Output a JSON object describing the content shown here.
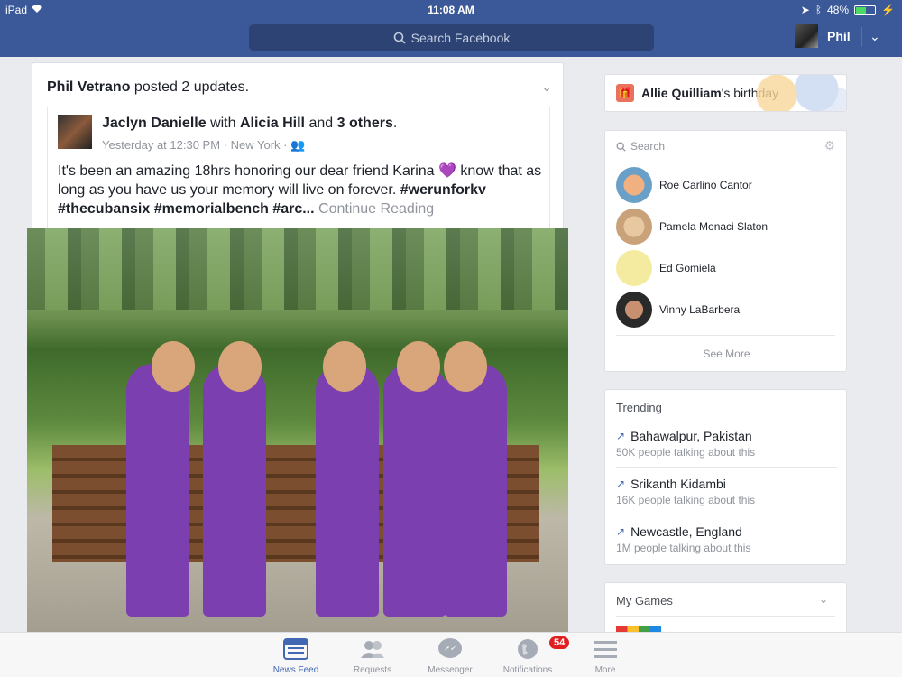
{
  "status_bar": {
    "device": "iPad",
    "time": "11:08 AM",
    "battery": "48%",
    "battery_level": 0.48
  },
  "header": {
    "search_placeholder": "Search Facebook",
    "user_name": "Phil"
  },
  "post": {
    "poster": "Phil Vetrano",
    "action": " posted 2 updates.",
    "author": "Jaclyn Danielle",
    "with_text": " with ",
    "tagged": "Alicia Hill",
    "and_text": " and ",
    "others": "3 others",
    "period": ".",
    "time": "Yesterday at 12:30 PM",
    "location": "New York",
    "text_part1": "It's been an amazing 18hrs honoring our dear friend Karina ",
    "heart": "💜",
    "text_part2": " know that as long as you have us your memory will live on forever.",
    "hashtags": "#werunforkv #thecubansix #memorialbench #arc...",
    "continue": "Continue Reading"
  },
  "birthday": {
    "name": "Allie Quilliam",
    "suffix": "'s birthday"
  },
  "contacts": {
    "search_label": "Search",
    "items": [
      {
        "name": "Roe Carlino Cantor"
      },
      {
        "name": "Pamela Monaci Slaton"
      },
      {
        "name": "Ed Gomiela"
      },
      {
        "name": "Vinny LaBarbera"
      }
    ],
    "see_more": "See More"
  },
  "trending": {
    "title": "Trending",
    "items": [
      {
        "topic": "Bahawalpur, Pakistan",
        "count": "50K people talking about this"
      },
      {
        "topic": "Srikanth Kidambi",
        "count": "16K people talking about this"
      },
      {
        "topic": "Newcastle, England",
        "count": "1M people talking about this"
      }
    ]
  },
  "games": {
    "title": "My Games"
  },
  "tabbar": {
    "tabs": [
      {
        "label": "News Feed"
      },
      {
        "label": "Requests"
      },
      {
        "label": "Messenger"
      },
      {
        "label": "Notifications",
        "badge": "54"
      },
      {
        "label": "More"
      }
    ]
  },
  "colors": {
    "brand": "#3b5998",
    "accent": "#4267b2",
    "badge": "#e02020"
  }
}
